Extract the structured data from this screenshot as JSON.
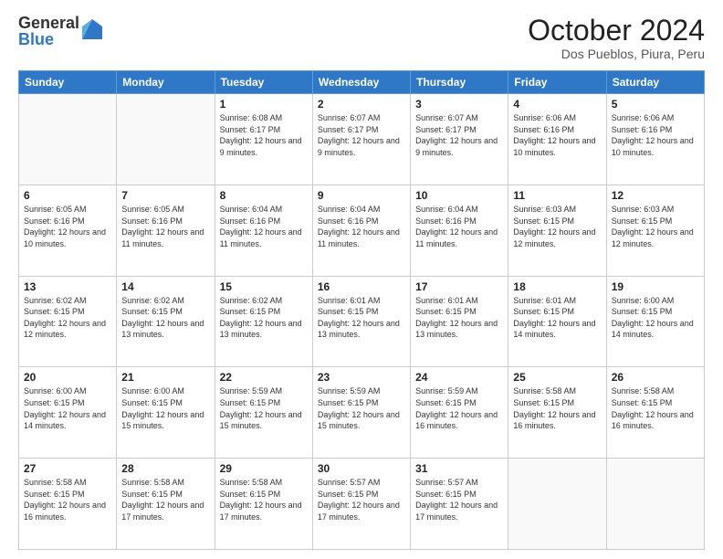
{
  "logo": {
    "general": "General",
    "blue": "Blue"
  },
  "header": {
    "month": "October 2024",
    "location": "Dos Pueblos, Piura, Peru"
  },
  "days_of_week": [
    "Sunday",
    "Monday",
    "Tuesday",
    "Wednesday",
    "Thursday",
    "Friday",
    "Saturday"
  ],
  "weeks": [
    [
      {
        "day": "",
        "info": ""
      },
      {
        "day": "",
        "info": ""
      },
      {
        "day": "1",
        "info": "Sunrise: 6:08 AM\nSunset: 6:17 PM\nDaylight: 12 hours and 9 minutes."
      },
      {
        "day": "2",
        "info": "Sunrise: 6:07 AM\nSunset: 6:17 PM\nDaylight: 12 hours and 9 minutes."
      },
      {
        "day": "3",
        "info": "Sunrise: 6:07 AM\nSunset: 6:17 PM\nDaylight: 12 hours and 9 minutes."
      },
      {
        "day": "4",
        "info": "Sunrise: 6:06 AM\nSunset: 6:16 PM\nDaylight: 12 hours and 10 minutes."
      },
      {
        "day": "5",
        "info": "Sunrise: 6:06 AM\nSunset: 6:16 PM\nDaylight: 12 hours and 10 minutes."
      }
    ],
    [
      {
        "day": "6",
        "info": "Sunrise: 6:05 AM\nSunset: 6:16 PM\nDaylight: 12 hours and 10 minutes."
      },
      {
        "day": "7",
        "info": "Sunrise: 6:05 AM\nSunset: 6:16 PM\nDaylight: 12 hours and 11 minutes."
      },
      {
        "day": "8",
        "info": "Sunrise: 6:04 AM\nSunset: 6:16 PM\nDaylight: 12 hours and 11 minutes."
      },
      {
        "day": "9",
        "info": "Sunrise: 6:04 AM\nSunset: 6:16 PM\nDaylight: 12 hours and 11 minutes."
      },
      {
        "day": "10",
        "info": "Sunrise: 6:04 AM\nSunset: 6:16 PM\nDaylight: 12 hours and 11 minutes."
      },
      {
        "day": "11",
        "info": "Sunrise: 6:03 AM\nSunset: 6:15 PM\nDaylight: 12 hours and 12 minutes."
      },
      {
        "day": "12",
        "info": "Sunrise: 6:03 AM\nSunset: 6:15 PM\nDaylight: 12 hours and 12 minutes."
      }
    ],
    [
      {
        "day": "13",
        "info": "Sunrise: 6:02 AM\nSunset: 6:15 PM\nDaylight: 12 hours and 12 minutes."
      },
      {
        "day": "14",
        "info": "Sunrise: 6:02 AM\nSunset: 6:15 PM\nDaylight: 12 hours and 13 minutes."
      },
      {
        "day": "15",
        "info": "Sunrise: 6:02 AM\nSunset: 6:15 PM\nDaylight: 12 hours and 13 minutes."
      },
      {
        "day": "16",
        "info": "Sunrise: 6:01 AM\nSunset: 6:15 PM\nDaylight: 12 hours and 13 minutes."
      },
      {
        "day": "17",
        "info": "Sunrise: 6:01 AM\nSunset: 6:15 PM\nDaylight: 12 hours and 13 minutes."
      },
      {
        "day": "18",
        "info": "Sunrise: 6:01 AM\nSunset: 6:15 PM\nDaylight: 12 hours and 14 minutes."
      },
      {
        "day": "19",
        "info": "Sunrise: 6:00 AM\nSunset: 6:15 PM\nDaylight: 12 hours and 14 minutes."
      }
    ],
    [
      {
        "day": "20",
        "info": "Sunrise: 6:00 AM\nSunset: 6:15 PM\nDaylight: 12 hours and 14 minutes."
      },
      {
        "day": "21",
        "info": "Sunrise: 6:00 AM\nSunset: 6:15 PM\nDaylight: 12 hours and 15 minutes."
      },
      {
        "day": "22",
        "info": "Sunrise: 5:59 AM\nSunset: 6:15 PM\nDaylight: 12 hours and 15 minutes."
      },
      {
        "day": "23",
        "info": "Sunrise: 5:59 AM\nSunset: 6:15 PM\nDaylight: 12 hours and 15 minutes."
      },
      {
        "day": "24",
        "info": "Sunrise: 5:59 AM\nSunset: 6:15 PM\nDaylight: 12 hours and 16 minutes."
      },
      {
        "day": "25",
        "info": "Sunrise: 5:58 AM\nSunset: 6:15 PM\nDaylight: 12 hours and 16 minutes."
      },
      {
        "day": "26",
        "info": "Sunrise: 5:58 AM\nSunset: 6:15 PM\nDaylight: 12 hours and 16 minutes."
      }
    ],
    [
      {
        "day": "27",
        "info": "Sunrise: 5:58 AM\nSunset: 6:15 PM\nDaylight: 12 hours and 16 minutes."
      },
      {
        "day": "28",
        "info": "Sunrise: 5:58 AM\nSunset: 6:15 PM\nDaylight: 12 hours and 17 minutes."
      },
      {
        "day": "29",
        "info": "Sunrise: 5:58 AM\nSunset: 6:15 PM\nDaylight: 12 hours and 17 minutes."
      },
      {
        "day": "30",
        "info": "Sunrise: 5:57 AM\nSunset: 6:15 PM\nDaylight: 12 hours and 17 minutes."
      },
      {
        "day": "31",
        "info": "Sunrise: 5:57 AM\nSunset: 6:15 PM\nDaylight: 12 hours and 17 minutes."
      },
      {
        "day": "",
        "info": ""
      },
      {
        "day": "",
        "info": ""
      }
    ]
  ]
}
